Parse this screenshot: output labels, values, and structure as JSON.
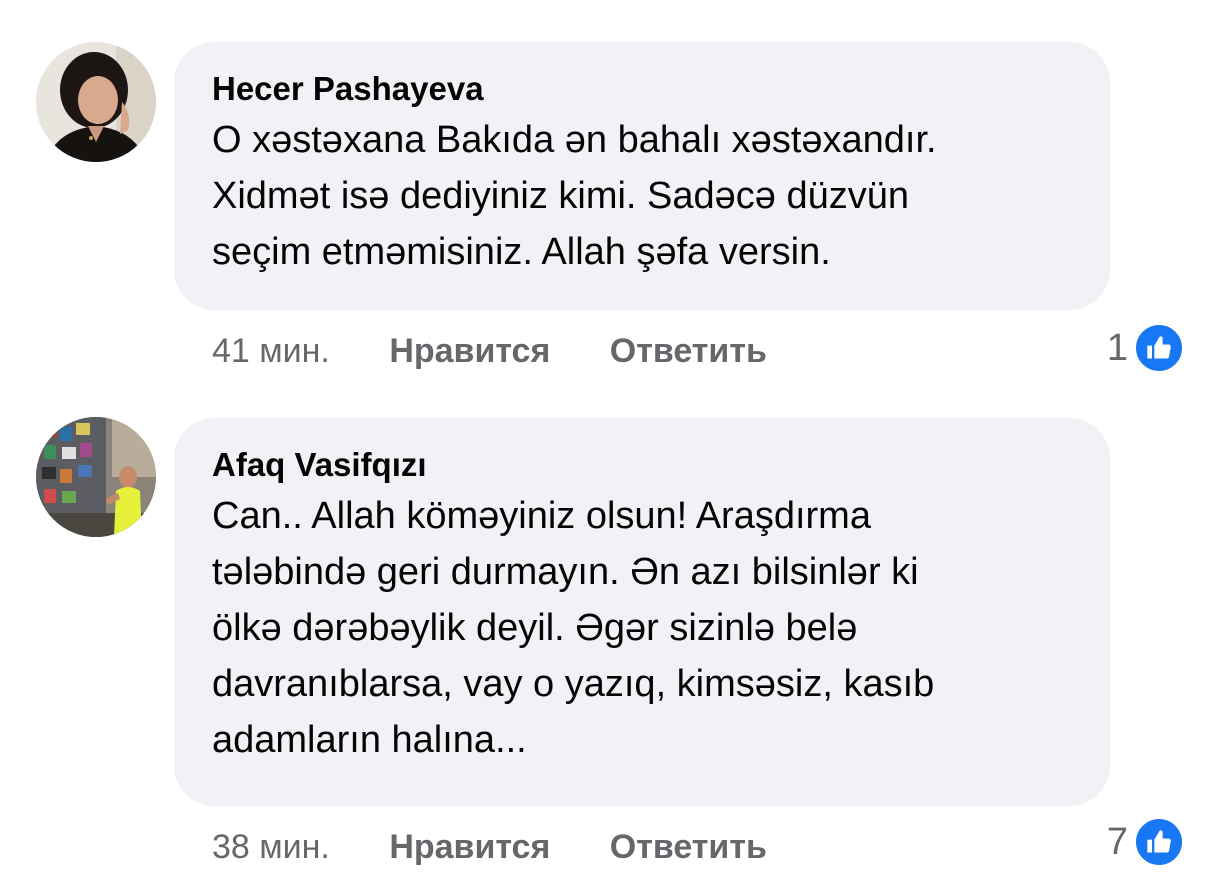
{
  "comments": [
    {
      "author": "Hecer Pashayeva",
      "text": "O xəstəxana Bakıda ən bahalı xəstəxandır.\nXidmət isə dediyiniz kimi. Sadəcə düzvün\nseçim etməmisiniz. Allah şəfa versin.",
      "time": "41 мин.",
      "like_label": "Нравится",
      "reply_label": "Ответить",
      "reaction_count": "1",
      "reaction_icon": "thumbs-up-icon",
      "reaction_color": "#1877f2"
    },
    {
      "author": "Afaq Vasifqızı",
      "text": "Can.. Allah köməyiniz olsun! Araşdırma\ntələbində geri durmayın. Ən azı bilsinlər ki\nölkə dərəbəylik deyil. Əgər sizinlə belə\ndavranıblarsa, vay o yazıq, kimsəsiz, kasıb\nadamların halına...",
      "time": "38 мин.",
      "like_label": "Нравится",
      "reply_label": "Ответить",
      "reaction_count": "7",
      "reaction_icon": "thumbs-up-icon",
      "reaction_color": "#1877f2"
    }
  ],
  "colors": {
    "bubble_bg": "#f0f2f5",
    "text": "#050505",
    "meta": "#65676b",
    "like_blue": "#1877f2"
  }
}
